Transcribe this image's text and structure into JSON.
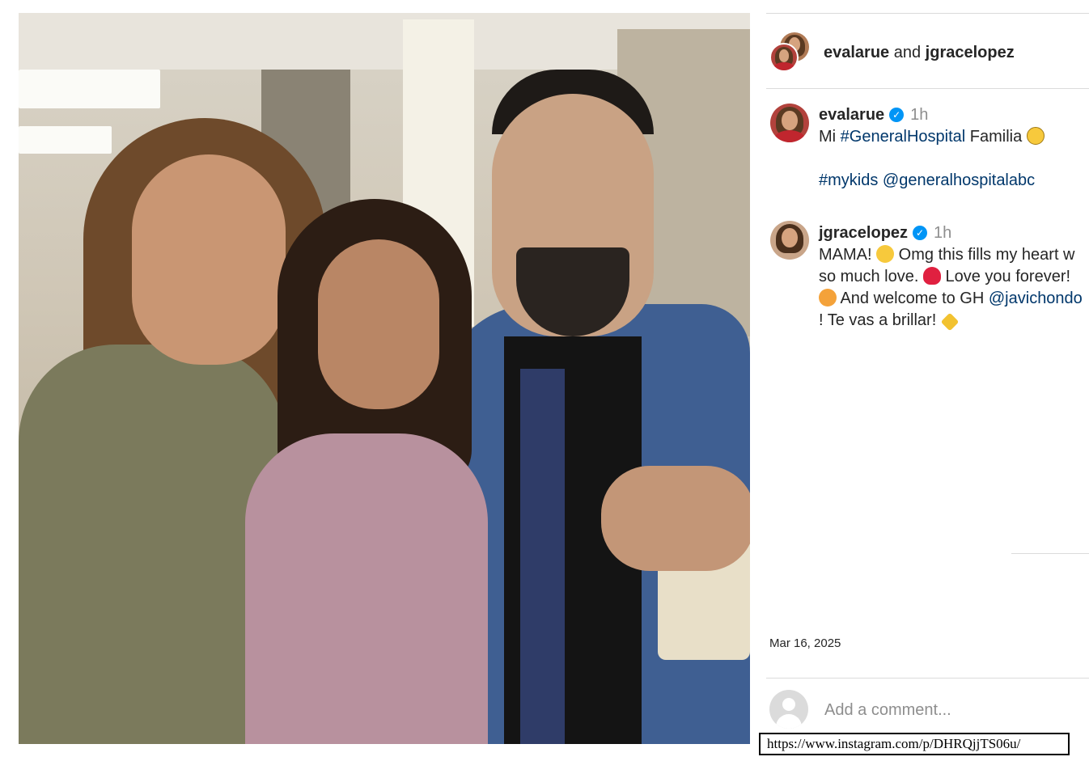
{
  "post": {
    "header": {
      "user1": "evalarue",
      "connector": "and",
      "user2": "jgracelopez"
    },
    "caption": {
      "username": "evalarue",
      "verified": true,
      "time": "1h",
      "line1_prefix": "Mi ",
      "line1_tag": "#GeneralHospital",
      "line1_suffix": " Familia",
      "line1_emoji": "grinning-face",
      "line2_tag": "#mykids",
      "line2_mention": "@generalhospitalabc"
    },
    "comment": {
      "username": "jgracelopez",
      "verified": true,
      "time": "1h",
      "part1": "MAMA!",
      "emoji1": "heart-eyes",
      "part2": " Omg this fills my heart w so much love.",
      "emoji2": "red-heart",
      "part3": " Love you forever!",
      "emoji3": "smiling-face-with-hearts",
      "part4": " And welcome to GH ",
      "mention": "@javichondo",
      "part5": " ! Te vas a brillar!",
      "emoji4": "sparkles"
    },
    "date": "Mar 16, 2025",
    "add_comment_placeholder": "Add a comment..."
  },
  "url": "https://www.instagram.com/p/DHRQjjTS06u/",
  "colors": {
    "link": "#00376b",
    "verified": "#0095f6",
    "muted": "#8e8e8e",
    "divider": "#dbdbdb"
  },
  "icons": [
    "verified-badge-icon",
    "default-avatar-icon"
  ]
}
